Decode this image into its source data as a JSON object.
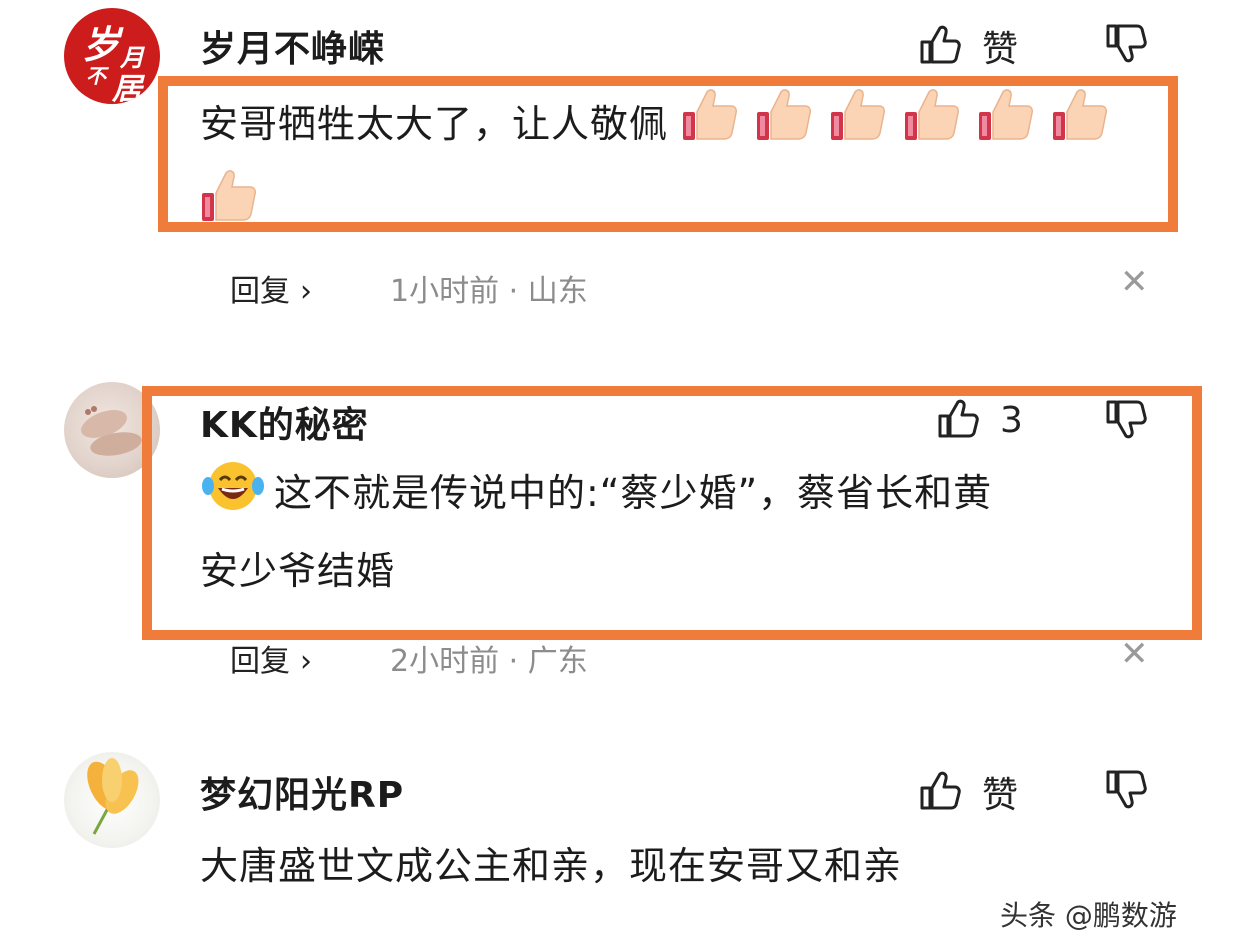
{
  "comments": [
    {
      "username": "岁月不峥嵘",
      "text": "安哥牺牲太大了，让人敬佩",
      "thumbs_count": 7,
      "like_label": "赞",
      "reply_label": "回复",
      "meta": "1小时前 · 山东",
      "avatar_text": [
        "岁",
        "月",
        "不",
        "居"
      ]
    },
    {
      "username": "KK的秘密",
      "text_line1": "这不就是传说中的:“蔡少婚”，蔡省长和黄",
      "text_line2": "安少爷结婚",
      "like_label": "3",
      "reply_label": "回复",
      "meta": "2小时前 · 广东"
    },
    {
      "username": "梦幻阳光RP",
      "text": "大唐盛世文成公主和亲，现在安哥又和亲",
      "like_label": "赞"
    }
  ],
  "watermark": "头条 @鹏数游"
}
